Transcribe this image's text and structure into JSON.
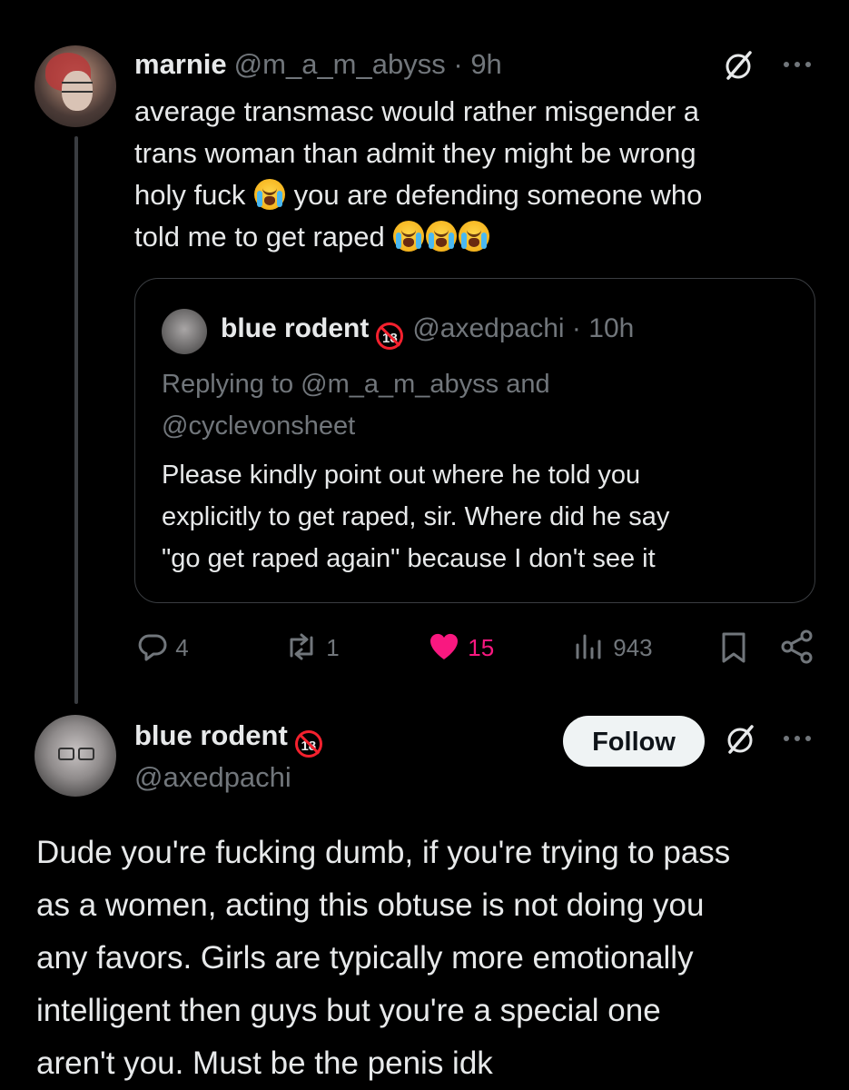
{
  "tweet1": {
    "author_name": "marnie",
    "handle": "@m_a_m_abyss",
    "separator": "·",
    "time": "9h",
    "text_line1": "average transmasc would rather misgender a",
    "text_line2": "trans woman than admit they might be wrong",
    "text_line3a": "holy fuck",
    "text_line3b": "you are defending someone who",
    "text_line4": "told me to get raped",
    "emoji": "loudly-crying-face-emoji",
    "quoted": {
      "author_name": "blue rodent",
      "age_badge": "18",
      "handle": "@axedpachi",
      "separator": "·",
      "time": "10h",
      "replying_to": "Replying to @m_a_m_abyss and\n@cyclevonsheet",
      "text": "Please kindly point out where he told you\nexplicitly to get raped, sir. Where did he say\n\"go get raped again\" because I don't see it"
    },
    "stats": {
      "replies": "4",
      "reposts": "1",
      "likes": "15",
      "views": "943"
    },
    "colors": {
      "like": "#f91880",
      "muted": "#71767b"
    }
  },
  "tweet2": {
    "author_name": "blue rodent",
    "age_badge": "18",
    "handle": "@axedpachi",
    "follow_label": "Follow",
    "text": "Dude you're fucking dumb, if you're trying to pass\nas a women, acting this obtuse is not doing you\nany favors. Girls are typically more emotionally\nintelligent then guys but you're a special one\naren't you. Must be the penis idk"
  },
  "icons": {
    "grok": "grok-icon",
    "more": "more-icon",
    "reply": "reply-icon",
    "repost": "repost-icon",
    "like": "heart-icon",
    "views": "views-icon",
    "bookmark": "bookmark-icon",
    "share": "share-icon"
  }
}
